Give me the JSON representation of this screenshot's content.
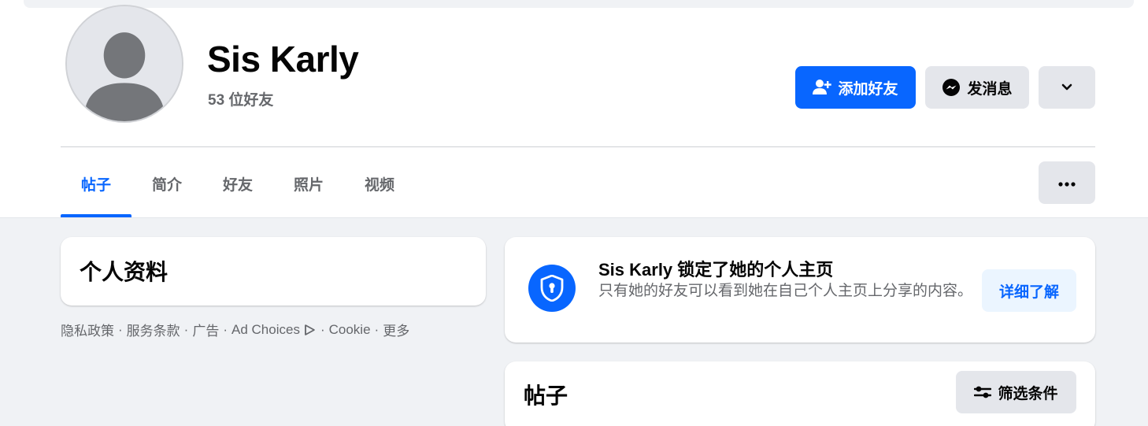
{
  "profile": {
    "name": "Sis Karly",
    "friend_count": "53 位好友"
  },
  "actions": {
    "add_friend": "添加好友",
    "message": "发消息"
  },
  "tabs": [
    {
      "label": "帖子",
      "active": true
    },
    {
      "label": "简介",
      "active": false
    },
    {
      "label": "好友",
      "active": false
    },
    {
      "label": "照片",
      "active": false
    },
    {
      "label": "视频",
      "active": false
    }
  ],
  "about": {
    "title": "个人资料"
  },
  "footer": {
    "privacy": "隐私政策",
    "terms": "服务条款",
    "ads": "广告",
    "ad_choices": "Ad Choices",
    "cookie": "Cookie",
    "more": "更多",
    "separator": "·"
  },
  "lock_notice": {
    "title": "Sis Karly 锁定了她的个人主页",
    "description": "只有她的好友可以看到她在自己个人主页上分享的内容。",
    "learn_more": "详细了解"
  },
  "posts": {
    "title": "帖子",
    "filter": "筛选条件"
  },
  "colors": {
    "primary": "#0866ff",
    "secondary_bg": "#e4e6eb",
    "page_bg": "#f0f2f5",
    "muted_text": "#65676b"
  },
  "icons": {
    "add_friend": "person-plus-icon",
    "message": "messenger-icon",
    "more": "chevron-down-icon",
    "dots": "more-dots-icon",
    "lock": "shield-lock-icon",
    "filter": "filter-sliders-icon",
    "ad_choices": "ad-choices-icon"
  }
}
